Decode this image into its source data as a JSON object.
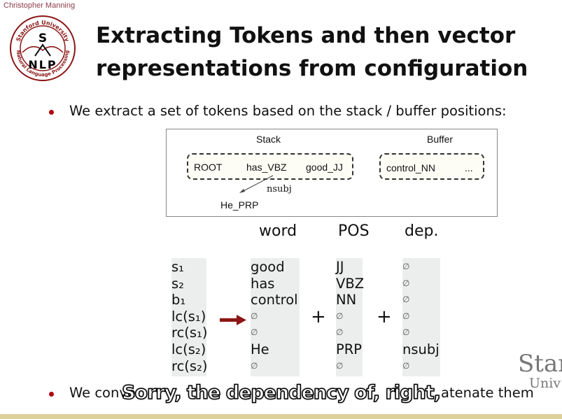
{
  "author": "Christopher Manning",
  "logo": {
    "top": "Stanford University",
    "letters": "S",
    "bottom_letters": "NLP",
    "bottom": "Natural Language Processing"
  },
  "title": {
    "line1": "Extracting Tokens and then vector",
    "line2": "representations from configuration"
  },
  "bullet1": "We extract a set of tokens based on the stack / buffer positions:",
  "diagram": {
    "stack_label": "Stack",
    "buffer_label": "Buffer",
    "stack": [
      "ROOT",
      "has_VBZ",
      "good_JJ"
    ],
    "buffer": [
      "control_NN",
      "..."
    ],
    "arc_label": "nsubj",
    "dependent": "He_PRP"
  },
  "table": {
    "headers": {
      "word": "word",
      "pos": "POS",
      "dep": "dep."
    },
    "rows": [
      {
        "label": "s₁",
        "word": "good",
        "pos": "JJ",
        "dep": "∅"
      },
      {
        "label": "s₂",
        "word": "has",
        "pos": "VBZ",
        "dep": "∅"
      },
      {
        "label": "b₁",
        "word": "control",
        "pos": "NN",
        "dep": "∅"
      },
      {
        "label": "lc(s₁)",
        "word": "∅",
        "pos": "∅",
        "dep": "∅"
      },
      {
        "label": "rc(s₁)",
        "word": "∅",
        "pos": "∅",
        "dep": "∅"
      },
      {
        "label": "lc(s₂)",
        "word": "He",
        "pos": "PRP",
        "dep": "nsubj"
      },
      {
        "label": "rc(s₂)",
        "word": "∅",
        "pos": "∅",
        "dep": "∅"
      }
    ],
    "plus": "+"
  },
  "bullet2": {
    "visible_start": "We conve",
    "visible_end": "atenate them"
  },
  "subtitle": "Sorry, the dependency of, right,",
  "footer_logo": {
    "line1": "Stan",
    "line2": "Univ"
  },
  "colors": {
    "accent": "#b1040e",
    "gold": "#dcd199"
  }
}
